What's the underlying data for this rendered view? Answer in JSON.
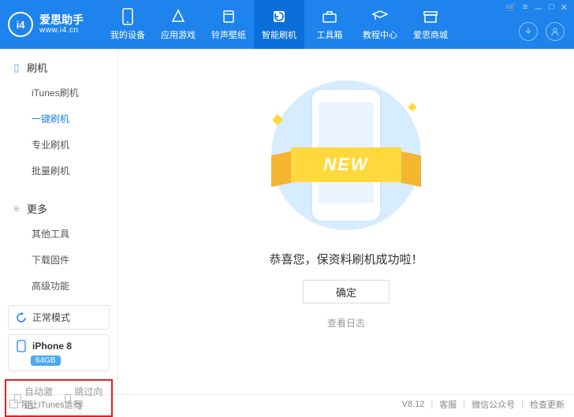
{
  "app": {
    "brand_cn": "爱思助手",
    "brand_url": "www.i4.cn",
    "logo_letters": "i4"
  },
  "nav": {
    "items": [
      {
        "label": "我的设备"
      },
      {
        "label": "应用游戏"
      },
      {
        "label": "铃声壁纸"
      },
      {
        "label": "智能刷机"
      },
      {
        "label": "工具箱"
      },
      {
        "label": "教程中心"
      },
      {
        "label": "爱思商城"
      }
    ]
  },
  "sidebar": {
    "section1": {
      "title": "刷机",
      "items": [
        "iTunes刷机",
        "一键刷机",
        "专业刷机",
        "批量刷机"
      ]
    },
    "section2": {
      "title": "更多",
      "items": [
        "其他工具",
        "下载固件",
        "高级功能"
      ]
    },
    "mode": "正常模式",
    "device": {
      "name": "iPhone 8",
      "storage": "64GB"
    },
    "redbox": {
      "opt1": "自动激活",
      "opt2": "跳过向导"
    }
  },
  "main": {
    "ribbon": "NEW",
    "message": "恭喜您，保资料刷机成功啦！",
    "ok": "确定",
    "log": "查看日志"
  },
  "footer": {
    "block_itunes": "阻止iTunes运行",
    "version": "V8.12",
    "kefu": "客服",
    "wx": "微信公众号",
    "update": "检查更新"
  }
}
